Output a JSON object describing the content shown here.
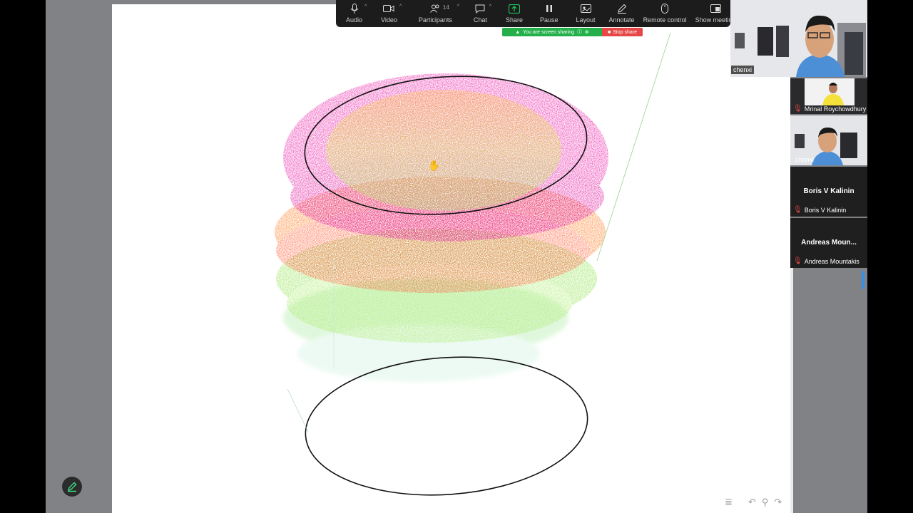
{
  "toolbar": {
    "audio": "Audio",
    "video": "Video",
    "participants": "Participants",
    "participants_count": "14",
    "chat": "Chat",
    "share": "Share",
    "pause": "Pause",
    "layout": "Layout",
    "annotate": "Annotate",
    "remote": "Remote control",
    "show_meeting": "Show meeting"
  },
  "share_bar": {
    "status": "You are screen sharing",
    "stop": "Stop share"
  },
  "video_panel": {
    "main_speaker": "chenxi",
    "tiles": [
      {
        "name": "Mrinal Roychowdhury"
      },
      {
        "name": "chenxi"
      },
      {
        "big": "Boris V Kalinin",
        "name": "Boris V Kalinin"
      },
      {
        "big": "Andreas Moun...",
        "name": "Andreas Mountakis"
      }
    ]
  },
  "colors": {
    "magenta": "#e6119e",
    "orange": "#ff6b1f",
    "green": "#96e44a",
    "share_green": "#23b04a",
    "stop_red": "#e74646"
  },
  "icons": [
    "mic-icon",
    "video-camera-icon",
    "people-icon",
    "chat-bubble-icon",
    "share-arrow-icon",
    "pause-icon",
    "layout-icon",
    "pencil-icon",
    "mouse-icon",
    "show-meeting-icon",
    "pencil-fab-icon",
    "hand-cursor-icon"
  ]
}
